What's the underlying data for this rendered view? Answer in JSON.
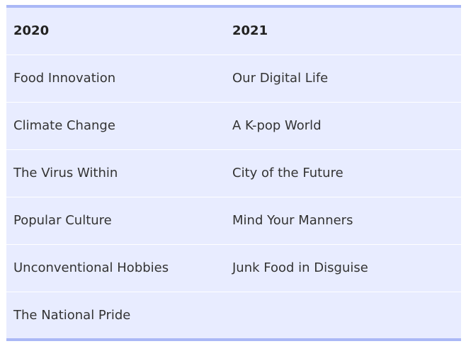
{
  "table": {
    "headers": [
      "2020",
      "2021"
    ],
    "rows": [
      [
        "Food Innovation",
        "Our Digital Life"
      ],
      [
        "Climate Change",
        "A K-pop World"
      ],
      [
        "The Virus Within",
        "City of the Future"
      ],
      [
        "Popular Culture",
        "Mind Your Manners"
      ],
      [
        "Unconventional Hobbies",
        "Junk Food in Disguise"
      ],
      [
        "The National Pride",
        ""
      ]
    ]
  },
  "colors": {
    "table_background": "#e8ecff",
    "border_accent": "#aab8f6",
    "row_divider": "#ffffff",
    "text": "#333333"
  }
}
